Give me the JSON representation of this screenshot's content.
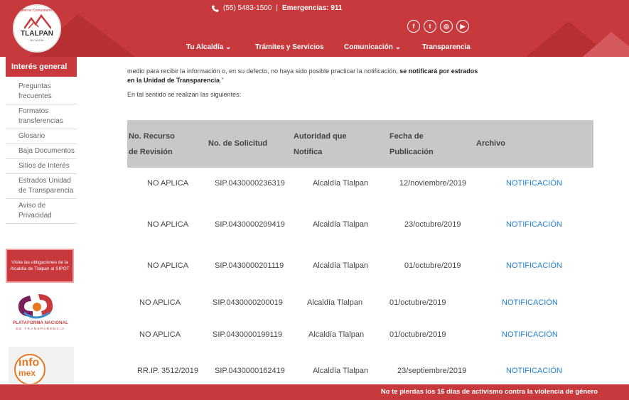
{
  "header": {
    "phone_number": "(55) 5483-1500",
    "separator": "|",
    "emergency_label": "Emergencias: 911",
    "logo_name": "TLALPAN",
    "logo_sub": "ALCALDÍA",
    "logo_arc": "Gobierno Comunitario",
    "social": [
      "facebook-icon",
      "twitter-icon",
      "instagram-icon",
      "youtube-icon"
    ],
    "nav": [
      {
        "label": "Tu Alcaldía",
        "has_dropdown": true
      },
      {
        "label": "Trámites y Servicios",
        "has_dropdown": false
      },
      {
        "label": "Comunicación",
        "has_dropdown": true
      },
      {
        "label": "Transparencia",
        "has_dropdown": false
      }
    ],
    "brand_color": "#c8393d"
  },
  "sidebar": {
    "title": "Interés general",
    "items": [
      {
        "label": "Preguntas frecuentes"
      },
      {
        "label": "Formatos transferencias"
      },
      {
        "label": "Glosario"
      },
      {
        "label": "Baja Documentos"
      },
      {
        "label": "Sitios de Interés"
      },
      {
        "label": "Estrados Unidad de Transparencia"
      },
      {
        "label": "Aviso de Privacidad"
      }
    ],
    "sipot_banner": "Visita las obligaciones de la Alcaldía de Tlalpan al SIPOT",
    "pnt_text": "PLATAFORMA NACIONAL",
    "pnt_sub": "DE TRANSPARENCIA",
    "infomex_t1": "info",
    "infomex_t2": "mex"
  },
  "content": {
    "intro_text": "medio para recibir la información o, en su defecto, no haya sido posible practicar la notificación,",
    "intro_bold_1": "se notificará",
    "intro_bold_2": "por estrados en la Unidad de Transparencia",
    "intro_end": ".\"",
    "intro2": "En tal sentido se realizan las siguientes:"
  },
  "table": {
    "headers": {
      "recurso_1": "No. Recurso",
      "recurso_2": "de Revisión",
      "solicitud": "No. de Solicitud",
      "autoridad_1": "Autoridad que",
      "autoridad_2": "Notifica",
      "fecha_1": "Fecha de",
      "fecha_2": "Publicación",
      "archivo": "Archivo"
    },
    "rows": [
      {
        "recurso": "NO APLICA",
        "solicitud": "SIP.0430000236319",
        "autoridad": "Alcaldía Tlalpan",
        "fecha": "12/noviembre/2019",
        "archivo": "NOTIFICACIÓN"
      },
      {
        "recurso": "NO APLICA",
        "solicitud": "SIP.0430000209419",
        "autoridad": "Alcaldía Tlalpan",
        "fecha": "23/octubre/2019",
        "archivo": "NOTIFICACIÓN"
      },
      {
        "recurso": "NO APLICA",
        "solicitud": "SIP.0430000201119",
        "autoridad": "Alcaldía Tlalpan",
        "fecha": "01/octubre/2019",
        "archivo": "NOTIFICACIÓN"
      },
      {
        "recurso": "NO APLICA",
        "solicitud": "SIP.0430000200019",
        "autoridad": "Alcaldía Tlalpan",
        "fecha": "01/octubre/2019",
        "archivo": "NOTIFICACIÓN"
      },
      {
        "recurso": "NO APLICA",
        "solicitud": "SIP.0430000199119",
        "autoridad": "Alcaldía Tlalpan",
        "fecha": "01/octubre/2019",
        "archivo": "NOTIFICACIÓN"
      },
      {
        "recurso": "RR.IP. 3512/2019",
        "solicitud": "SIP.0430000162419",
        "autoridad": "Alcaldía Tlalpan",
        "fecha": "23/septiembre/2019",
        "archivo": "NOTIFICACIÓN"
      }
    ]
  },
  "footer": {
    "text": "No te pierdas los 16 días de activismo contra la violencia de género"
  }
}
